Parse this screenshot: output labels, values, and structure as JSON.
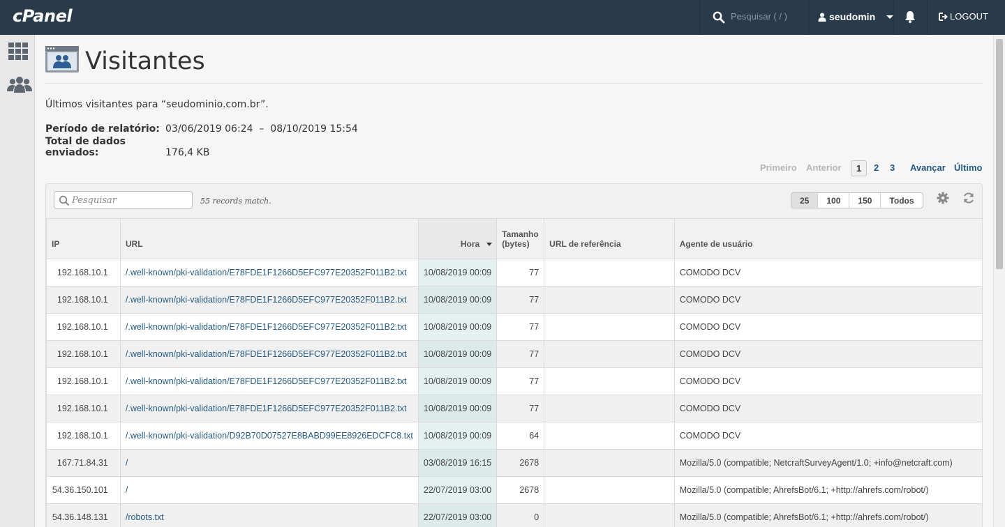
{
  "topbar": {
    "logo": "cPanel",
    "search_placeholder": "Pesquisar ( / )",
    "username": "seudomin",
    "logout_label": "LOGOUT"
  },
  "page": {
    "title": "Visitantes",
    "intro": "Últimos visitantes para “seudominio.com.br”.",
    "period_label": "Período de relatório:",
    "period_value": "03/06/2019 06:24  –  08/10/2019 15:54",
    "total_label": "Total de dados enviados:",
    "total_value": "176,4 KB"
  },
  "pagination": {
    "first": "Primeiro",
    "prev": "Anterior",
    "pages": [
      "1",
      "2",
      "3"
    ],
    "next": "Avançar",
    "last": "Último"
  },
  "table_controls": {
    "search_placeholder": "Pesquisar",
    "records_text": "55 records match.",
    "page_sizes": [
      "25",
      "100",
      "150",
      "Todos"
    ]
  },
  "table": {
    "headers": [
      "IP",
      "URL",
      "Hora",
      "Tamanho (bytes)",
      "URL de referência",
      "Agente de usuário"
    ],
    "rows": [
      {
        "ip": "192.168.10.1",
        "url": "/.well-known/pki-validation/E78FDE1F1266D5EFC977E20352F011B2.txt",
        "hora": "10/08/2019 00:09",
        "size": "77",
        "ref": "",
        "agent": "COMODO DCV"
      },
      {
        "ip": "192.168.10.1",
        "url": "/.well-known/pki-validation/E78FDE1F1266D5EFC977E20352F011B2.txt",
        "hora": "10/08/2019 00:09",
        "size": "77",
        "ref": "",
        "agent": "COMODO DCV"
      },
      {
        "ip": "192.168.10.1",
        "url": "/.well-known/pki-validation/E78FDE1F1266D5EFC977E20352F011B2.txt",
        "hora": "10/08/2019 00:09",
        "size": "77",
        "ref": "",
        "agent": "COMODO DCV"
      },
      {
        "ip": "192.168.10.1",
        "url": "/.well-known/pki-validation/E78FDE1F1266D5EFC977E20352F011B2.txt",
        "hora": "10/08/2019 00:09",
        "size": "77",
        "ref": "",
        "agent": "COMODO DCV"
      },
      {
        "ip": "192.168.10.1",
        "url": "/.well-known/pki-validation/E78FDE1F1266D5EFC977E20352F011B2.txt",
        "hora": "10/08/2019 00:09",
        "size": "77",
        "ref": "",
        "agent": "COMODO DCV"
      },
      {
        "ip": "192.168.10.1",
        "url": "/.well-known/pki-validation/E78FDE1F1266D5EFC977E20352F011B2.txt",
        "hora": "10/08/2019 00:09",
        "size": "77",
        "ref": "",
        "agent": "COMODO DCV"
      },
      {
        "ip": "192.168.10.1",
        "url": "/.well-known/pki-validation/D92B70D07527E8BABD99EE8926EDCFC8.txt",
        "hora": "10/08/2019 00:09",
        "size": "64",
        "ref": "",
        "agent": "COMODO DCV"
      },
      {
        "ip": "167.71.84.31",
        "url": "/",
        "hora": "03/08/2019 16:15",
        "size": "2678",
        "ref": "",
        "agent": "Mozilla/5.0 (compatible; NetcraftSurveyAgent/1.0; +info@netcraft.com)"
      },
      {
        "ip": "54.36.150.101",
        "url": "/",
        "hora": "22/07/2019 03:00",
        "size": "2678",
        "ref": "",
        "agent": "Mozilla/5.0 (compatible; AhrefsBot/6.1; +http://ahrefs.com/robot/)"
      },
      {
        "ip": "54.36.148.131",
        "url": "/robots.txt",
        "hora": "22/07/2019 03:00",
        "size": "0",
        "ref": "",
        "agent": "Mozilla/5.0 (compatible; AhrefsBot/6.1; +http://ahrefs.com/robot/)"
      }
    ]
  }
}
